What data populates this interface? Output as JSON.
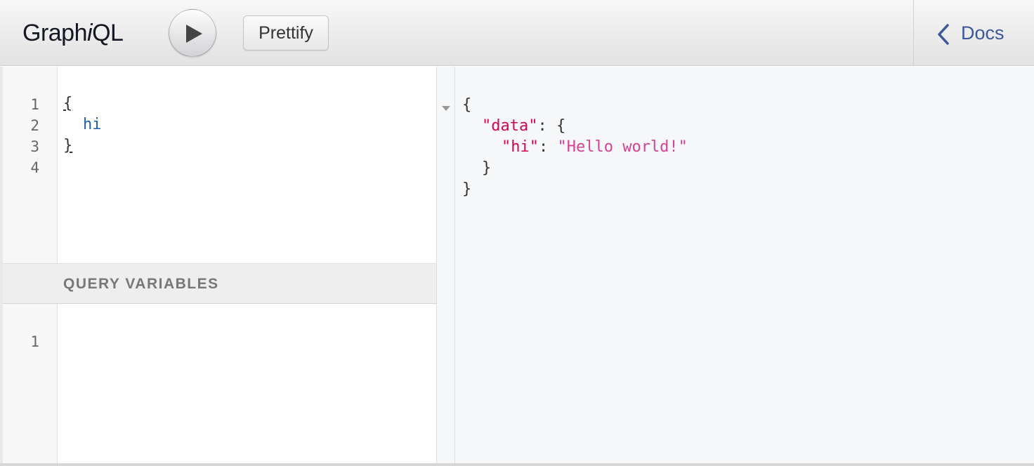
{
  "topbar": {
    "title_prefix": "Graph",
    "title_italic": "i",
    "title_suffix": "QL",
    "execute_icon": "play-icon",
    "prettify_label": "Prettify"
  },
  "docs": {
    "icon": "chevron-left-icon",
    "label": "Docs"
  },
  "query_editor": {
    "line_numbers": [
      "1",
      "2",
      "3",
      "4"
    ],
    "lines": [
      "{",
      "hi",
      "}",
      ""
    ]
  },
  "variables": {
    "title": "QUERY VARIABLES",
    "line_numbers": [
      "1"
    ]
  },
  "result": {
    "fold_icon": "fold-arrow-icon",
    "open_brace": "{",
    "data_key": "\"data\"",
    "data_colon": ": {",
    "hi_key": "\"hi\"",
    "hi_colon": ": ",
    "hi_value": "\"Hello world!\"",
    "inner_close": "}",
    "outer_close": "}"
  },
  "colors": {
    "accent": "#3b5998",
    "field": "#1f61a0",
    "json_key": "#d2054e",
    "json_string": "#d64292"
  }
}
